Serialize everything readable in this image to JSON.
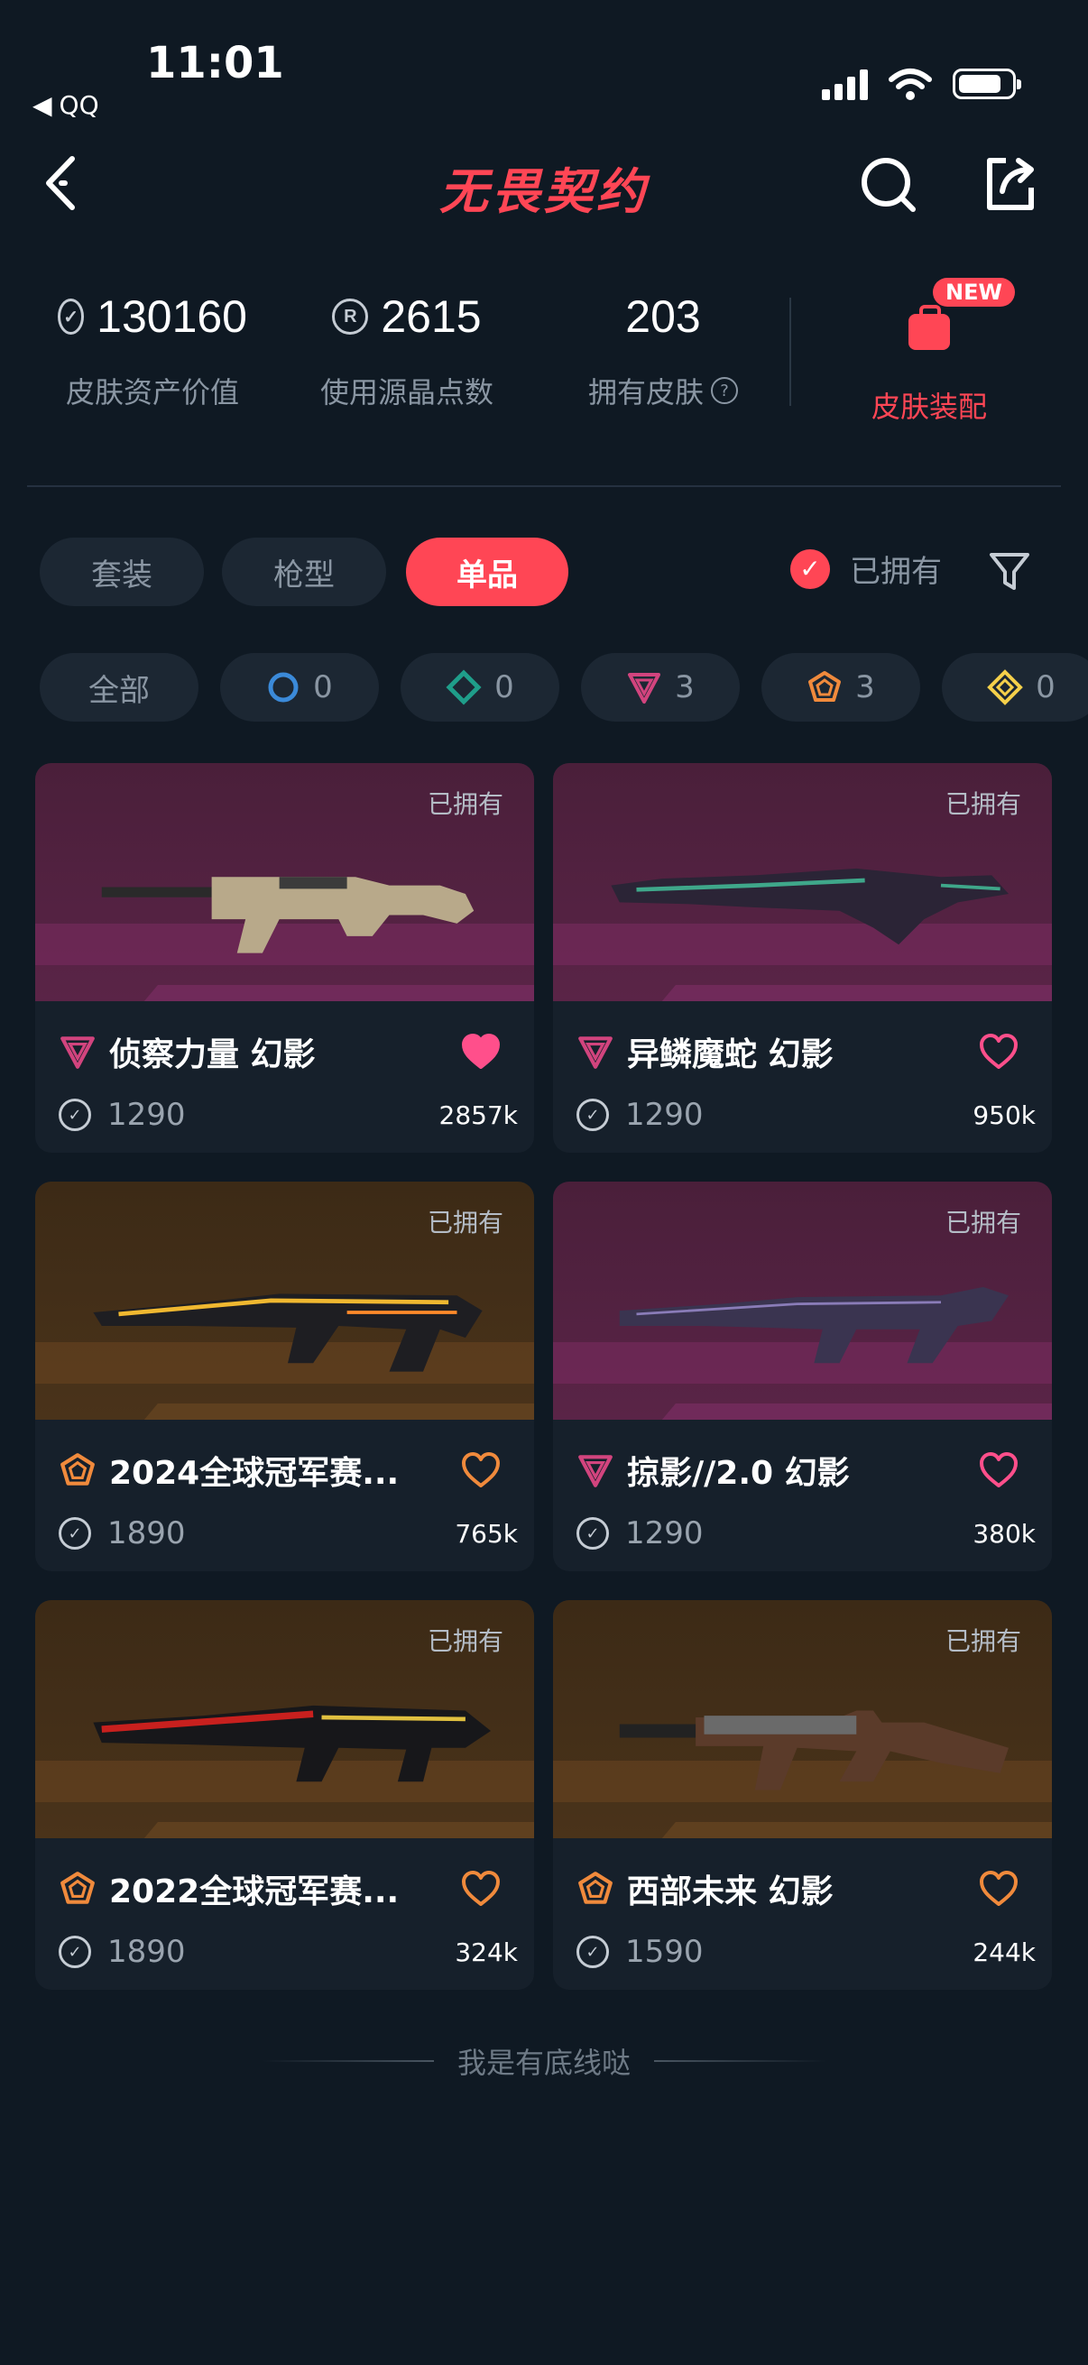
{
  "status": {
    "time": "11:01",
    "back_app": "QQ"
  },
  "nav": {
    "title": "无畏契约"
  },
  "stats": [
    {
      "value": "130160",
      "label": "皮肤资产价值",
      "icon": "vp-coin-icon"
    },
    {
      "value": "2615",
      "label": "使用源晶点数",
      "icon": "radianite-icon"
    },
    {
      "value": "203",
      "label": "拥有皮肤",
      "icon": "help-circle-icon"
    }
  ],
  "equip": {
    "badge": "NEW",
    "label": "皮肤装配"
  },
  "tabs": [
    "套装",
    "枪型",
    "单品"
  ],
  "active_tab": "单品",
  "owned_filter": {
    "label": "已拥有",
    "checked": true
  },
  "rarity_chips": [
    {
      "label": "全部",
      "count": ""
    },
    {
      "icon": "select-tier-icon",
      "color": "#3b8ad9",
      "count": "0"
    },
    {
      "icon": "deluxe-tier-icon",
      "color": "#1f9e8a",
      "count": "0"
    },
    {
      "icon": "premium-tier-icon",
      "color": "#d2447e",
      "count": "3"
    },
    {
      "icon": "exclusive-tier-icon",
      "color": "#f08a3c",
      "count": "3"
    },
    {
      "icon": "ultra-tier-icon",
      "color": "#f5d04a",
      "count": "0"
    }
  ],
  "cards": [
    {
      "name": "侦察力量 幻影",
      "price": "1290",
      "likes": "2857k",
      "owned": "已拥有",
      "tier_color": "#d2447e",
      "liked": true,
      "theme": "purple"
    },
    {
      "name": "异鳞魔蛇 幻影",
      "price": "1290",
      "likes": "950k",
      "owned": "已拥有",
      "tier_color": "#d2447e",
      "liked": false,
      "theme": "purple"
    },
    {
      "name": "2024全球冠军赛...",
      "price": "1890",
      "likes": "765k",
      "owned": "已拥有",
      "tier_color": "#f08a3c",
      "liked": false,
      "theme": "amber"
    },
    {
      "name": "掠影//2.0 幻影",
      "price": "1290",
      "likes": "380k",
      "owned": "已拥有",
      "tier_color": "#d2447e",
      "liked": false,
      "theme": "purple"
    },
    {
      "name": "2022全球冠军赛...",
      "price": "1890",
      "likes": "324k",
      "owned": "已拥有",
      "tier_color": "#f08a3c",
      "liked": false,
      "theme": "amber"
    },
    {
      "name": "西部未来 幻影",
      "price": "1590",
      "likes": "244k",
      "owned": "已拥有",
      "tier_color": "#f08a3c",
      "liked": false,
      "theme": "amber"
    }
  ],
  "footer": "我是有底线哒"
}
